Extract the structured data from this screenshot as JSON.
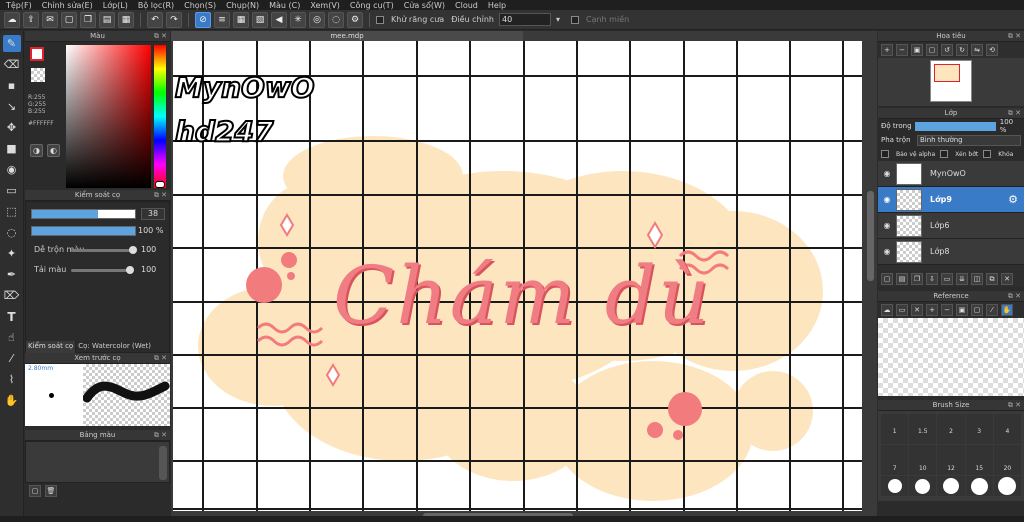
{
  "menu": [
    "Tệp(F)",
    "Chỉnh sửa(E)",
    "Lớp(L)",
    "Bộ lọc(R)",
    "Chọn(S)",
    "Chụp(N)",
    "Màu (C)",
    "Xem(V)",
    "Công cụ(T)",
    "Cửa sổ(W)",
    "Cloud",
    "Help"
  ],
  "toolbar": {
    "antialias_label": "Khử răng cưa",
    "adjust_label": "Điều chỉnh",
    "adjust_value": "40",
    "snap_label": "Cạnh miền"
  },
  "color_panel": {
    "title": "Màu",
    "r": "R:255",
    "g": "G:255",
    "b": "B:255",
    "hex": "#FFFFFF",
    "primary": "#ffffff",
    "accent": "#e0232a"
  },
  "brush_control": {
    "title": "Kiểm soát cọ",
    "size_value": "38",
    "opacity_value": "100 %",
    "blend_label": "Dễ trộn màu",
    "blend_value": "100",
    "load_label": "Tải màu",
    "load_value": "100",
    "tab_control": "Kiểm soát cọ",
    "tab_brush": "Cọ: Watercolor (Wet)"
  },
  "brush_preview": {
    "title": "Xem trước cọ",
    "size_text": "2.80mm"
  },
  "palette": {
    "title": "Bảng màu"
  },
  "document": {
    "tab_name": "mee.mdp"
  },
  "artwork": {
    "line1": "MynOwO",
    "line2": "hd247",
    "headline": "Chám dù",
    "blob_color": "#fde6bf",
    "text_color": "#f07c84"
  },
  "navigator": {
    "title": "Hoa tiêu"
  },
  "layers": {
    "title": "Lớp",
    "opacity_label": "Độ trong",
    "opacity_value": "100 %",
    "blend_label": "Pha trộn",
    "blend_value": "Bình thường",
    "protect_alpha": "Bảo vệ alpha",
    "clipping": "Xén bớt",
    "lock": "Khóa",
    "items": [
      {
        "name": "MynOwO",
        "selected": false
      },
      {
        "name": "Lớp9",
        "selected": true
      },
      {
        "name": "Lớp6",
        "selected": false
      },
      {
        "name": "Lớp8",
        "selected": false
      }
    ]
  },
  "reference": {
    "title": "Reference"
  },
  "brush_size": {
    "title": "Brush Size",
    "sizes": [
      "1",
      "1.5",
      "2",
      "3",
      "4",
      "7",
      "10",
      "12",
      "15",
      "20"
    ]
  }
}
